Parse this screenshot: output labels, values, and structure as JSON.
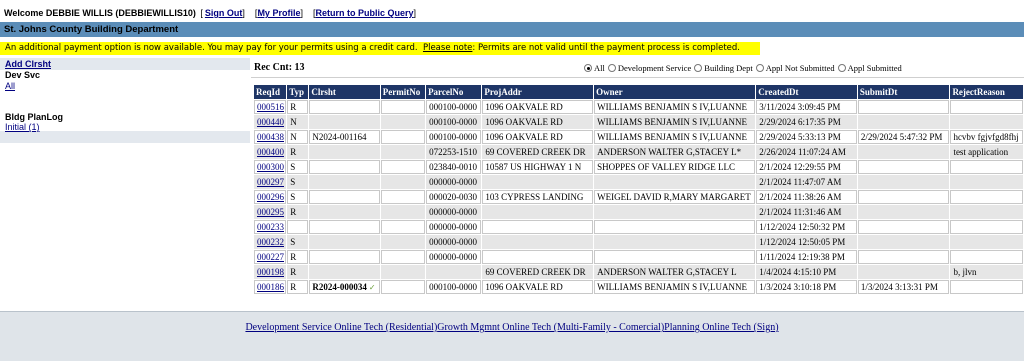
{
  "header": {
    "welcome": "Welcome DEBBIE WILLIS (DEBBIEWILLIS10)",
    "sign_out": "Sign Out",
    "my_profile": "My Profile",
    "return_public": "Return to Public Query",
    "bracket_open": "[",
    "bracket_close": "]"
  },
  "dept_title": "St. Johns County Building Department",
  "notice": {
    "text1": "An additional payment option is now available.  You may pay for your permits using a credit card.",
    "note_link": "Please note",
    "text2": ": Permits are not valid until the payment process is completed."
  },
  "sidebar": {
    "add_clrsht": "Add Clrsht",
    "dev_svc_title": "Dev Svc",
    "dev_svc_all": "All",
    "bldg_title": "Bldg PlanLog",
    "bldg_initial": "Initial (1)"
  },
  "rec_count": "Rec Cnt: 13",
  "filters": [
    {
      "label": "All",
      "selected": true
    },
    {
      "label": "Development Service",
      "selected": false
    },
    {
      "label": "Building Dept",
      "selected": false
    },
    {
      "label": "Appl Not Submitted",
      "selected": false
    },
    {
      "label": "Appl Submitted",
      "selected": false
    }
  ],
  "table": {
    "columns": [
      "ReqId",
      "Typ",
      "Clrsht",
      "PermitNo",
      "ParcelNo",
      "ProjAddr",
      "Owner",
      "CreatedDt",
      "SubmitDt",
      "RejectReason"
    ],
    "rows": [
      {
        "reqid": "000516",
        "typ": "R",
        "clrsht": "",
        "permit": "",
        "parcel": "000100-0000",
        "addr": "1096 OAKVALE RD",
        "owner": "WILLIAMS BENJAMIN S IV,LUANNE",
        "created": "3/11/2024 3:09:45 PM",
        "submit": "",
        "reject": ""
      },
      {
        "reqid": "000440",
        "typ": "N",
        "clrsht": "",
        "permit": "",
        "parcel": "000100-0000",
        "addr": "1096 OAKVALE RD",
        "owner": "WILLIAMS BENJAMIN S IV,LUANNE",
        "created": "2/29/2024 6:17:35 PM",
        "submit": "",
        "reject": ""
      },
      {
        "reqid": "000438",
        "typ": "N",
        "clrsht": "N2024-001164",
        "permit": "",
        "parcel": "000100-0000",
        "addr": "1096 OAKVALE RD",
        "owner": "WILLIAMS BENJAMIN S IV,LUANNE",
        "created": "2/29/2024 5:33:13 PM",
        "submit": "2/29/2024 5:47:32 PM",
        "reject": "hcvbv fgjvfgd8fhj"
      },
      {
        "reqid": "000400",
        "typ": "R",
        "clrsht": "",
        "permit": "",
        "parcel": "072253-1510",
        "addr": "69 COVERED CREEK DR",
        "owner": "ANDERSON WALTER G,STACEY L*",
        "created": "2/26/2024 11:07:24 AM",
        "submit": "",
        "reject": "test application"
      },
      {
        "reqid": "000300",
        "typ": "S",
        "clrsht": "",
        "permit": "",
        "parcel": "023840-0010",
        "addr": "10587 US HIGHWAY 1 N",
        "owner": "SHOPPES OF VALLEY RIDGE LLC",
        "created": "2/1/2024 12:29:55 PM",
        "submit": "",
        "reject": ""
      },
      {
        "reqid": "000297",
        "typ": "S",
        "clrsht": "",
        "permit": "",
        "parcel": "000000-0000",
        "addr": "",
        "owner": "",
        "created": "2/1/2024 11:47:07 AM",
        "submit": "",
        "reject": ""
      },
      {
        "reqid": "000296",
        "typ": "S",
        "clrsht": "",
        "permit": "",
        "parcel": "000020-0030",
        "addr": "103 CYPRESS LANDING",
        "owner": "WEIGEL DAVID R,MARY MARGARET",
        "created": "2/1/2024 11:38:26 AM",
        "submit": "",
        "reject": ""
      },
      {
        "reqid": "000295",
        "typ": "R",
        "clrsht": "",
        "permit": "",
        "parcel": "000000-0000",
        "addr": "",
        "owner": "",
        "created": "2/1/2024 11:31:46 AM",
        "submit": "",
        "reject": ""
      },
      {
        "reqid": "000233",
        "typ": "",
        "clrsht": "",
        "permit": "",
        "parcel": "000000-0000",
        "addr": "",
        "owner": "",
        "created": "1/12/2024 12:50:32 PM",
        "submit": "",
        "reject": ""
      },
      {
        "reqid": "000232",
        "typ": "S",
        "clrsht": "",
        "permit": "",
        "parcel": "000000-0000",
        "addr": "",
        "owner": "",
        "created": "1/12/2024 12:50:05 PM",
        "submit": "",
        "reject": ""
      },
      {
        "reqid": "000227",
        "typ": "R",
        "clrsht": "",
        "permit": "",
        "parcel": "000000-0000",
        "addr": "",
        "owner": "",
        "created": "1/11/2024 12:19:38 PM",
        "submit": "",
        "reject": ""
      },
      {
        "reqid": "000198",
        "typ": "R",
        "clrsht": "",
        "permit": "",
        "parcel": "",
        "addr": "69 COVERED CREEK DR",
        "owner": "ANDERSON WALTER G,STACEY L",
        "created": "1/4/2024 4:15:10 PM",
        "submit": "",
        "reject": "b, jlvn"
      },
      {
        "reqid": "000186",
        "typ": "R",
        "clrsht": "R2024-000034",
        "permit": "",
        "parcel": "000100-0000",
        "addr": "1096 OAKVALE RD",
        "owner": "WILLIAMS BENJAMIN S IV,LUANNE",
        "created": "1/3/2024 3:10:18 PM",
        "submit": "1/3/2024 3:13:31 PM",
        "reject": "",
        "checked": true
      }
    ]
  },
  "footer": {
    "links": [
      "Development Service Online Tech (Residential)",
      "Growth Mgmnt Online Tech (Multi-Family - Comercial)",
      "Planning Online Tech (Sign)"
    ]
  }
}
